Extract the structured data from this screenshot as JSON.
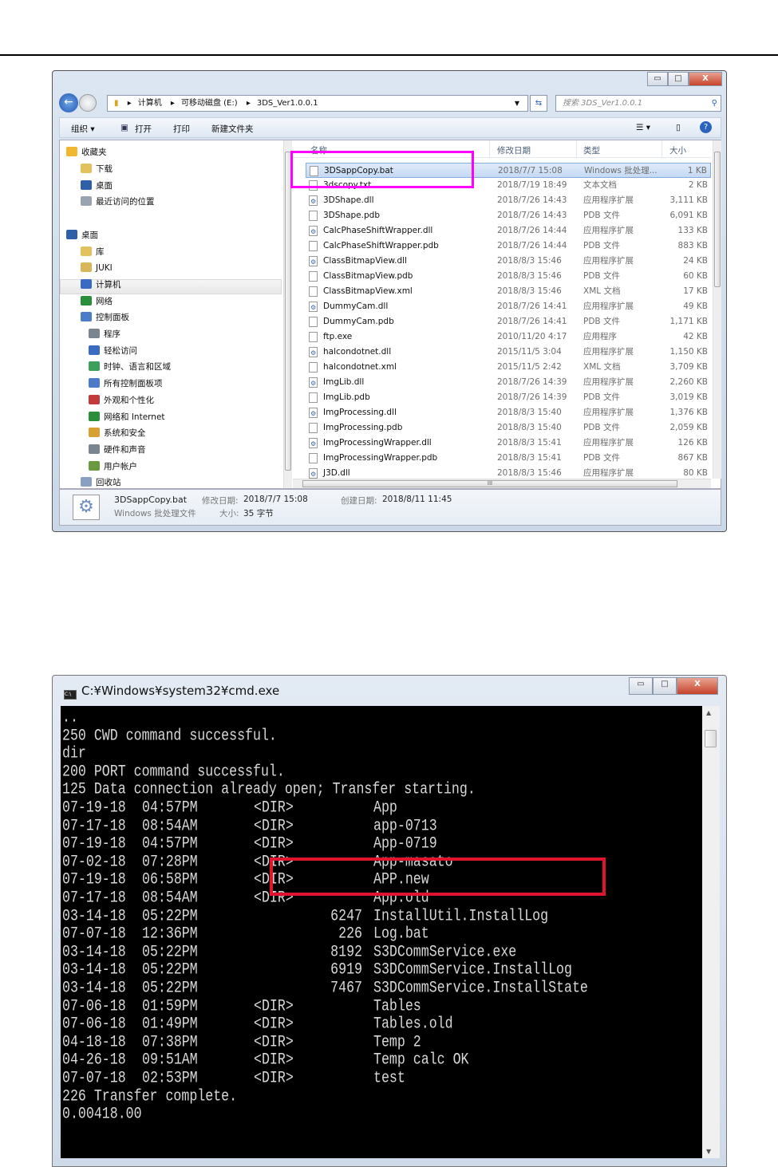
{
  "explorer": {
    "caption_buttons": {
      "minimize": "▭",
      "maximize": "□",
      "close": "X"
    },
    "breadcrumb": [
      "计算机",
      "可移动磁盘 (E:)",
      "3DS_Ver1.0.0.1"
    ],
    "search_placeholder": "搜索 3DS_Ver1.0.0.1",
    "toolbar": {
      "organize": "组织 ▾",
      "open": "打开",
      "print": "打印",
      "new_folder": "新建文件夹"
    },
    "nav": [
      {
        "label": "收藏夹",
        "color": "#f2b630",
        "indent": 0
      },
      {
        "label": "下载",
        "color": "#e3c25b",
        "indent": 1
      },
      {
        "label": "桌面",
        "color": "#2f5fa8",
        "indent": 1
      },
      {
        "label": "最近访问的位置",
        "color": "#9aa4b0",
        "indent": 1
      },
      {
        "label": "桌面",
        "color": "#2f5fa8",
        "indent": 0
      },
      {
        "label": "库",
        "color": "#e3c25b",
        "indent": 1
      },
      {
        "label": "JUKI",
        "color": "#d8b75a",
        "indent": 1
      },
      {
        "label": "计算机",
        "color": "#3a6bc2",
        "indent": 1
      },
      {
        "label": "网络",
        "color": "#2a8f3a",
        "indent": 1
      },
      {
        "label": "控制面板",
        "color": "#4c7cc8",
        "indent": 1
      },
      {
        "label": "程序",
        "color": "#7b8590",
        "indent": 2
      },
      {
        "label": "轻松访问",
        "color": "#3a6bc2",
        "indent": 2
      },
      {
        "label": "时钟、语言和区域",
        "color": "#3aa05a",
        "indent": 2
      },
      {
        "label": "所有控制面板项",
        "color": "#4c7cc8",
        "indent": 2
      },
      {
        "label": "外观和个性化",
        "color": "#c23a3a",
        "indent": 2
      },
      {
        "label": "网络和 Internet",
        "color": "#2a8f3a",
        "indent": 2
      },
      {
        "label": "系统和安全",
        "color": "#d8a030",
        "indent": 2
      },
      {
        "label": "硬件和声音",
        "color": "#7b8590",
        "indent": 2
      },
      {
        "label": "用户帐户",
        "color": "#6a9a40",
        "indent": 2
      },
      {
        "label": "回收站",
        "color": "#8aa0c0",
        "indent": 1
      }
    ],
    "columns": {
      "name": "名称",
      "date": "修改日期",
      "type": "类型",
      "size": "大小"
    },
    "files": [
      {
        "name": "3DSappCopy.bat",
        "date": "2018/7/7 15:08",
        "type": "Windows 批处理...",
        "size": "1 KB",
        "icon": "bat",
        "selected": true
      },
      {
        "name": "3dscopy.txt",
        "date": "2018/7/19 18:49",
        "type": "文本文档",
        "size": "2 KB",
        "icon": "file"
      },
      {
        "name": "3DShape.dll",
        "date": "2018/7/26 14:43",
        "type": "应用程序扩展",
        "size": "3,111 KB",
        "icon": "dll"
      },
      {
        "name": "3DShape.pdb",
        "date": "2018/7/26 14:43",
        "type": "PDB 文件",
        "size": "6,091 KB",
        "icon": "file"
      },
      {
        "name": "CalcPhaseShiftWrapper.dll",
        "date": "2018/7/26 14:44",
        "type": "应用程序扩展",
        "size": "133 KB",
        "icon": "dll"
      },
      {
        "name": "CalcPhaseShiftWrapper.pdb",
        "date": "2018/7/26 14:44",
        "type": "PDB 文件",
        "size": "883 KB",
        "icon": "file"
      },
      {
        "name": "ClassBitmapView.dll",
        "date": "2018/8/3 15:46",
        "type": "应用程序扩展",
        "size": "24 KB",
        "icon": "dll"
      },
      {
        "name": "ClassBitmapView.pdb",
        "date": "2018/8/3 15:46",
        "type": "PDB 文件",
        "size": "60 KB",
        "icon": "file"
      },
      {
        "name": "ClassBitmapView.xml",
        "date": "2018/8/3 15:46",
        "type": "XML 文档",
        "size": "17 KB",
        "icon": "xml"
      },
      {
        "name": "DummyCam.dll",
        "date": "2018/7/26 14:41",
        "type": "应用程序扩展",
        "size": "49 KB",
        "icon": "dll"
      },
      {
        "name": "DummyCam.pdb",
        "date": "2018/7/26 14:41",
        "type": "PDB 文件",
        "size": "1,171 KB",
        "icon": "file"
      },
      {
        "name": "ftp.exe",
        "date": "2010/11/20 4:17",
        "type": "应用程序",
        "size": "42 KB",
        "icon": "exe"
      },
      {
        "name": "halcondotnet.dll",
        "date": "2015/11/5 3:04",
        "type": "应用程序扩展",
        "size": "1,150 KB",
        "icon": "dll"
      },
      {
        "name": "halcondotnet.xml",
        "date": "2015/11/5 2:42",
        "type": "XML 文档",
        "size": "3,709 KB",
        "icon": "xml"
      },
      {
        "name": "ImgLib.dll",
        "date": "2018/7/26 14:39",
        "type": "应用程序扩展",
        "size": "2,260 KB",
        "icon": "dll"
      },
      {
        "name": "ImgLib.pdb",
        "date": "2018/7/26 14:39",
        "type": "PDB 文件",
        "size": "3,019 KB",
        "icon": "file"
      },
      {
        "name": "ImgProcessing.dll",
        "date": "2018/8/3 15:40",
        "type": "应用程序扩展",
        "size": "1,376 KB",
        "icon": "dll"
      },
      {
        "name": "ImgProcessing.pdb",
        "date": "2018/8/3 15:40",
        "type": "PDB 文件",
        "size": "2,059 KB",
        "icon": "file"
      },
      {
        "name": "ImgProcessingWrapper.dll",
        "date": "2018/8/3 15:41",
        "type": "应用程序扩展",
        "size": "126 KB",
        "icon": "dll"
      },
      {
        "name": "ImgProcessingWrapper.pdb",
        "date": "2018/8/3 15:41",
        "type": "PDB 文件",
        "size": "867 KB",
        "icon": "file"
      },
      {
        "name": "J3D.dll",
        "date": "2018/8/3 15:46",
        "type": "应用程序扩展",
        "size": "80 KB",
        "icon": "dll"
      }
    ],
    "details": {
      "name": "3DSappCopy.bat",
      "type": "Windows 批处理文件",
      "modified_label": "修改日期:",
      "modified": "2018/7/7 15:08",
      "created_label": "创建日期:",
      "created": "2018/8/11 11:45",
      "size_label": "大小:",
      "size": "35 字节"
    },
    "highlight_color": "#ff00ff"
  },
  "cmd": {
    "title": "C:¥Windows¥system32¥cmd.exe",
    "text_lines": [
      "..",
      "250 CWD command successful.",
      "dir",
      "200 PORT command successful.",
      "125 Data connection already open; Transfer starting."
    ],
    "entries": [
      {
        "date": "07-19-18",
        "time": "04:57PM",
        "dir": "<DIR>",
        "size": "",
        "name": "App"
      },
      {
        "date": "07-17-18",
        "time": "08:54AM",
        "dir": "<DIR>",
        "size": "",
        "name": "app-0713"
      },
      {
        "date": "07-19-18",
        "time": "04:57PM",
        "dir": "<DIR>",
        "size": "",
        "name": "App-0719"
      },
      {
        "date": "07-02-18",
        "time": "07:28PM",
        "dir": "<DIR>",
        "size": "",
        "name": "App-masato"
      },
      {
        "date": "07-19-18",
        "time": "06:58PM",
        "dir": "<DIR>",
        "size": "",
        "name": "APP.new"
      },
      {
        "date": "07-17-18",
        "time": "08:54AM",
        "dir": "<DIR>",
        "size": "",
        "name": "App.old"
      },
      {
        "date": "03-14-18",
        "time": "05:22PM",
        "dir": "",
        "size": "6247",
        "name": "InstallUtil.InstallLog"
      },
      {
        "date": "07-07-18",
        "time": "12:36PM",
        "dir": "",
        "size": "226",
        "name": "Log.bat"
      },
      {
        "date": "03-14-18",
        "time": "05:22PM",
        "dir": "",
        "size": "8192",
        "name": "S3DCommService.exe"
      },
      {
        "date": "03-14-18",
        "time": "05:22PM",
        "dir": "",
        "size": "6919",
        "name": "S3DCommService.InstallLog"
      },
      {
        "date": "03-14-18",
        "time": "05:22PM",
        "dir": "",
        "size": "7467",
        "name": "S3DCommService.InstallState"
      },
      {
        "date": "07-06-18",
        "time": "01:59PM",
        "dir": "<DIR>",
        "size": "",
        "name": "Tables"
      },
      {
        "date": "07-06-18",
        "time": "01:49PM",
        "dir": "<DIR>",
        "size": "",
        "name": "Tables.old"
      },
      {
        "date": "04-18-18",
        "time": "07:38PM",
        "dir": "<DIR>",
        "size": "",
        "name": "Temp 2"
      },
      {
        "date": "04-26-18",
        "time": "09:51AM",
        "dir": "<DIR>",
        "size": "",
        "name": "Temp calc OK"
      },
      {
        "date": "07-07-18",
        "time": "02:53PM",
        "dir": "<DIR>",
        "size": "",
        "name": "test"
      }
    ],
    "tail_lines": [
      "226 Transfer complete.",
      "0.00418.00"
    ],
    "highlight_color": "#e0142c"
  }
}
